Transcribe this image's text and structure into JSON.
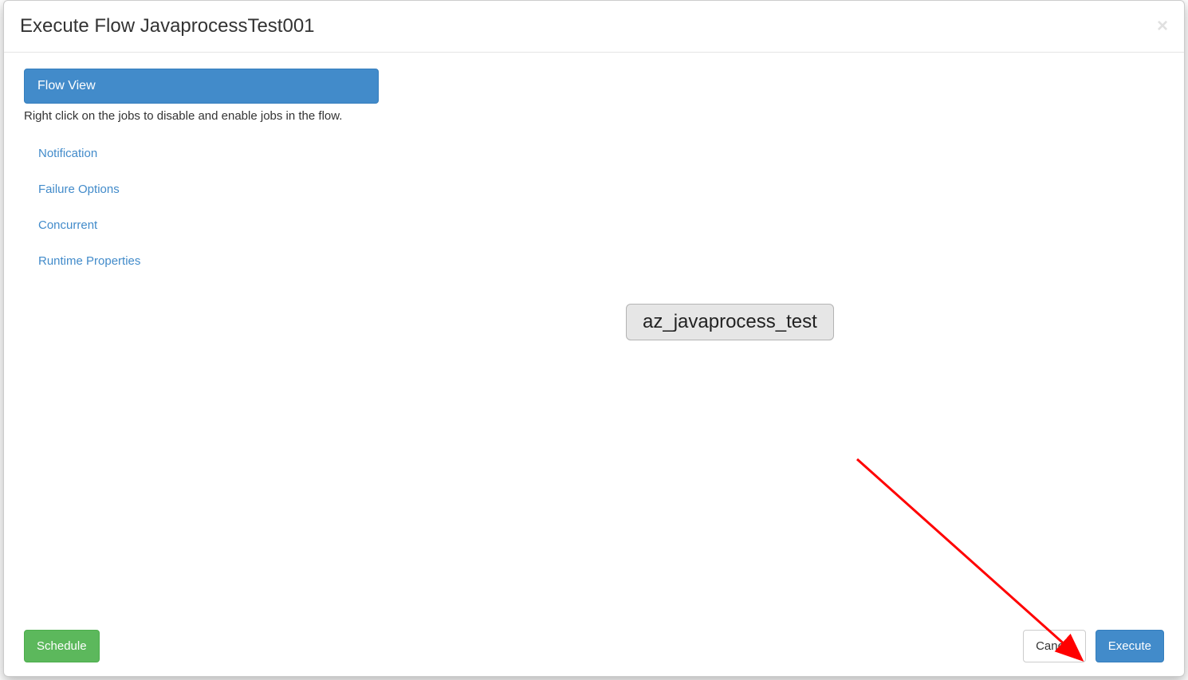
{
  "modal": {
    "title": "Execute Flow JavaprocessTest001",
    "close_glyph": "×"
  },
  "sidebar": {
    "active_panel": {
      "label": "Flow View",
      "hint": "Right click on the jobs to disable and enable jobs in the flow."
    },
    "nav": [
      {
        "label": "Notification"
      },
      {
        "label": "Failure Options"
      },
      {
        "label": "Concurrent"
      },
      {
        "label": "Runtime Properties"
      }
    ]
  },
  "flow": {
    "job_node_label": "az_javaprocess_test"
  },
  "footer": {
    "schedule_label": "Schedule",
    "cancel_label": "Cancel",
    "execute_label": "Execute"
  }
}
